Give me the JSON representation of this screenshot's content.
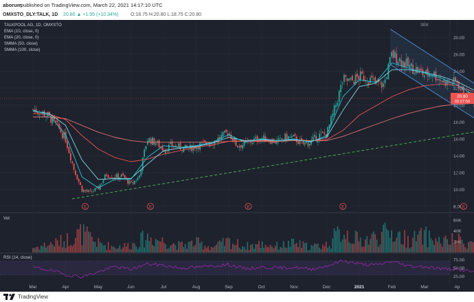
{
  "header": {
    "author": "aborum",
    "published": "published on TradingView.com, March 22, 2021 14:17:10 UTC"
  },
  "quote": {
    "symbol": "OMXSTO_DLY:TALK, 1D",
    "change": "20.80 ▲ +1.95 (+10.34%)",
    "ohlc": "O:18.75 H:20.80 L:18.75 C:20.80"
  },
  "legend": {
    "title": "TALKPOOL AG, 1D, OMXSTO",
    "indicators": [
      "EMA (10, close, 0)",
      "EMA (20, close, 0)",
      "SMMA (50, close)",
      "SMMA (100, close)"
    ],
    "volume_label": "Vol",
    "rsi_label": "RSI (14, close)"
  },
  "currency": "SEK",
  "colors": {
    "background": "#1e222d",
    "up": "#26a69a",
    "down": "#ef5350",
    "ema10": "#26c6da",
    "ema20": "#80deea",
    "smma50": "#ef5350",
    "smma100": "#e57373",
    "trendline": "#4caf50",
    "channel": "#4a90d9",
    "rsi": "#9c27b0"
  },
  "footer": {
    "brand": "TradingView"
  },
  "chart_data": {
    "type": "candlestick",
    "price_axis": {
      "ticks": [
        "28.00",
        "26.00",
        "24.00",
        "22.00",
        "20.00",
        "18.00",
        "16.00",
        "14.00",
        "12.00",
        "10.00",
        "8.00"
      ],
      "ylim": [
        7.6,
        29.6
      ]
    },
    "current_price": {
      "label": "20.80",
      "value": 20.8,
      "countdown": "02:27:50"
    },
    "x_axis": {
      "ticks": [
        "Mar",
        "Apr",
        "May",
        "Jun",
        "Jul",
        "Aug",
        "Sep",
        "Oct",
        "Nov",
        "Dec",
        "2021",
        "Feb",
        "Mar",
        "Ap"
      ]
    },
    "volume_axis": {
      "ticks": [
        "60K",
        "40K",
        "20K"
      ],
      "ylim": [
        0,
        70000
      ]
    },
    "rsi_axis": {
      "ticks": [
        "75.00",
        "50.00",
        "25.00"
      ],
      "ylim": [
        10,
        90
      ]
    },
    "earnings_markers": [
      {
        "label": "E",
        "month_index": 1.6
      },
      {
        "label": "E",
        "month_index": 3.6
      },
      {
        "label": "E",
        "month_index": 6.6
      },
      {
        "label": "E",
        "month_index": 9.5
      },
      {
        "label": "E",
        "month_index": 13.2
      }
    ],
    "trendline": {
      "start": {
        "month_index": 1.2,
        "price": 8.9
      },
      "end": {
        "month_index": 14.1,
        "price": 17.2
      }
    },
    "channel": {
      "upper": [
        {
          "month_index": 10.95,
          "price": 29.0
        },
        {
          "month_index": 13.55,
          "price": 22.5
        }
      ],
      "lower": [
        {
          "month_index": 10.95,
          "price": 24.8
        },
        {
          "month_index": 13.55,
          "price": 18.4
        }
      ]
    },
    "close_series": {
      "month_index": [
        0,
        0.25,
        0.5,
        0.75,
        1,
        1.25,
        1.5,
        1.75,
        2,
        2.25,
        2.5,
        2.75,
        3,
        3.25,
        3.5,
        3.75,
        4,
        4.25,
        4.5,
        4.75,
        5,
        5.25,
        5.5,
        5.75,
        6,
        6.25,
        6.5,
        6.75,
        7,
        7.25,
        7.5,
        7.75,
        8,
        8.25,
        8.5,
        8.75,
        9,
        9.25,
        9.5,
        9.75,
        10,
        10.25,
        10.5,
        10.75,
        11,
        11.25,
        11.5,
        11.75,
        12,
        12.25,
        12.5,
        12.75,
        13,
        13.25,
        13.5
      ],
      "price": [
        19.5,
        19.2,
        18.6,
        17.5,
        16.0,
        12.5,
        10.0,
        9.6,
        10.2,
        11.8,
        11.5,
        11.6,
        10.6,
        11.5,
        16.0,
        15.6,
        14.8,
        15.2,
        15.0,
        14.8,
        15.2,
        15.4,
        15.6,
        16.2,
        16.8,
        15.2,
        15.4,
        15.8,
        16.1,
        15.9,
        15.6,
        16.2,
        16.1,
        15.4,
        15.6,
        16.4,
        16.6,
        19.6,
        23.0,
        22.8,
        23.4,
        23.2,
        22.6,
        22.4,
        26.0,
        25.4,
        24.6,
        24.2,
        23.6,
        23.8,
        23.0,
        22.6,
        22.8,
        21.0,
        20.8
      ]
    },
    "indicator_series": {
      "month_index": [
        0,
        0.5,
        1,
        1.5,
        2,
        2.5,
        3,
        3.5,
        4,
        4.5,
        5,
        5.5,
        6,
        6.5,
        7,
        7.5,
        8,
        8.5,
        9,
        9.5,
        10,
        10.5,
        11,
        11.5,
        12,
        12.5,
        13,
        13.5
      ],
      "ema10": [
        19.4,
        18.8,
        16.5,
        11.5,
        10.2,
        11.2,
        11.2,
        13.8,
        15.2,
        15.0,
        15.2,
        15.6,
        16.5,
        15.6,
        16.0,
        15.8,
        16.0,
        15.6,
        16.4,
        21.0,
        23.0,
        22.7,
        25.0,
        24.4,
        23.8,
        23.2,
        22.4,
        21.2
      ],
      "ema20": [
        19.3,
        19.0,
        17.6,
        13.5,
        11.2,
        11.3,
        11.3,
        13.0,
        14.6,
        14.9,
        15.1,
        15.5,
        16.2,
        15.8,
        15.9,
        15.8,
        15.9,
        15.7,
        16.2,
        19.4,
        22.2,
        22.6,
        24.2,
        24.2,
        23.9,
        23.4,
        22.8,
        21.8
      ],
      "smma50": [
        19.0,
        18.9,
        18.3,
        16.4,
        14.8,
        13.8,
        13.3,
        13.6,
        14.2,
        14.6,
        15.0,
        15.3,
        15.7,
        15.8,
        15.8,
        15.8,
        15.9,
        15.8,
        15.9,
        17.0,
        18.8,
        19.9,
        21.0,
        21.8,
        22.3,
        22.5,
        22.3,
        21.6
      ],
      "smma100": [
        18.6,
        18.6,
        18.4,
        17.6,
        16.8,
        16.2,
        15.8,
        15.6,
        15.6,
        15.6,
        15.6,
        15.6,
        15.7,
        15.7,
        15.7,
        15.7,
        15.8,
        15.8,
        15.8,
        16.3,
        17.0,
        17.7,
        18.4,
        19.0,
        19.5,
        19.9,
        20.1,
        20.2
      ]
    },
    "rsi_series": {
      "month_index": [
        0,
        0.5,
        1,
        1.5,
        2,
        2.5,
        3,
        3.5,
        4,
        4.5,
        5,
        5.5,
        6,
        6.5,
        7,
        7.5,
        8,
        8.5,
        9,
        9.5,
        10,
        10.5,
        11,
        11.5,
        12,
        12.5,
        13,
        13.5
      ],
      "value": [
        52,
        44,
        30,
        24,
        38,
        54,
        46,
        62,
        58,
        50,
        52,
        56,
        60,
        48,
        52,
        50,
        52,
        46,
        56,
        72,
        62,
        58,
        70,
        56,
        54,
        48,
        46,
        38
      ]
    },
    "volume_series": {
      "month_index": [
        0,
        0.5,
        1,
        1.5,
        2,
        2.5,
        3,
        3.5,
        4,
        4.5,
        5,
        5.5,
        6,
        6.5,
        7,
        7.5,
        8,
        8.5,
        9,
        9.5,
        10,
        10.5,
        11,
        11.5,
        12,
        12.5,
        13,
        13.5
      ],
      "value": [
        12000,
        20000,
        30000,
        48000,
        22000,
        14000,
        18000,
        38000,
        28000,
        17000,
        24000,
        13000,
        27000,
        15000,
        21000,
        16000,
        22000,
        14000,
        19000,
        55000,
        28000,
        38000,
        50000,
        30000,
        40000,
        26000,
        30000,
        22000
      ]
    }
  }
}
